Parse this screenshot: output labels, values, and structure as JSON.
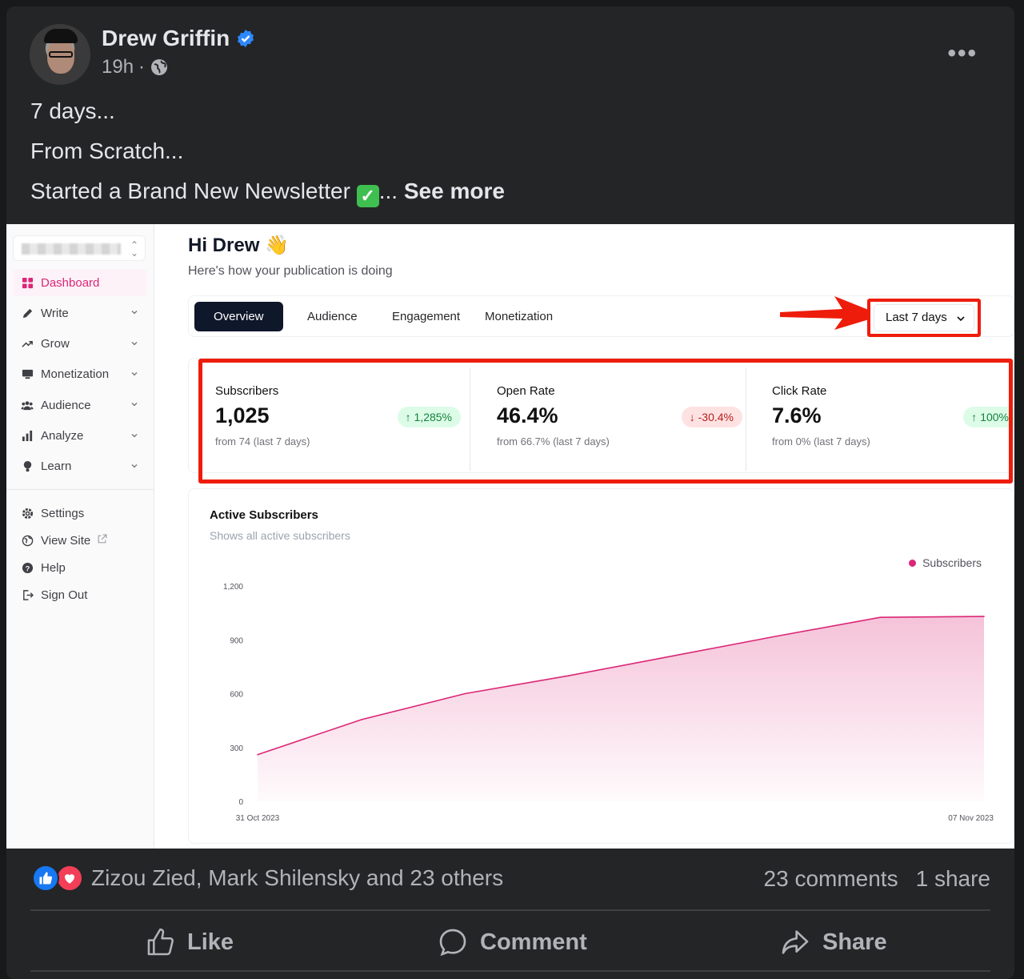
{
  "post": {
    "author": "Drew Griffin",
    "time": "19h",
    "separator": "·",
    "more_label": "•••",
    "lines": [
      "7 days...",
      "From Scratch...",
      "Started a Brand New Newsletter"
    ],
    "line3_suffix": "...",
    "see_more": "See more"
  },
  "dashboard": {
    "sidebar": {
      "items": [
        {
          "label": "Dashboard",
          "icon": "grid-icon"
        },
        {
          "label": "Write",
          "icon": "pencil-icon"
        },
        {
          "label": "Grow",
          "icon": "trend-icon"
        },
        {
          "label": "Monetization",
          "icon": "monitor-icon"
        },
        {
          "label": "Audience",
          "icon": "users-icon"
        },
        {
          "label": "Analyze",
          "icon": "bar-chart-icon"
        },
        {
          "label": "Learn",
          "icon": "bulb-icon"
        }
      ],
      "bottom_items": [
        {
          "label": "Settings",
          "icon": "gear-icon"
        },
        {
          "label": "View Site",
          "icon": "globe-icon"
        },
        {
          "label": "Help",
          "icon": "help-icon"
        },
        {
          "label": "Sign Out",
          "icon": "sign-out-icon"
        }
      ]
    },
    "greeting": "Hi Drew 👋",
    "subtitle": "Here's how your publication is doing",
    "tabs": [
      "Overview",
      "Audience",
      "Engagement",
      "Monetization"
    ],
    "range": "Last 7 days",
    "stats": [
      {
        "label": "Subscribers",
        "value": "1,025",
        "change": "1,285%",
        "direction": "up",
        "from": "from 74 (last 7 days)"
      },
      {
        "label": "Open Rate",
        "value": "46.4%",
        "change": "-30.4%",
        "direction": "down",
        "from": "from 66.7% (last 7 days)"
      },
      {
        "label": "Click Rate",
        "value": "7.6%",
        "change": "100%",
        "direction": "up",
        "from": "from 0% (last 7 days)"
      }
    ],
    "chart_title": "Active Subscribers",
    "chart_subtitle": "Shows all active subscribers"
  },
  "chart_data": {
    "type": "area",
    "title": "Active Subscribers",
    "subtitle": "Shows all active subscribers",
    "xlabel": "",
    "ylabel": "",
    "x_tick_labels": [
      "31 Oct 2023",
      "07 Nov 2023"
    ],
    "y_ticks": [
      0,
      300,
      600,
      900,
      1200
    ],
    "y_tick_labels": [
      "0",
      "300",
      "600",
      "900",
      "1,200"
    ],
    "ylim": [
      0,
      1200
    ],
    "x": [
      0,
      1,
      2,
      3,
      4,
      5,
      6,
      7
    ],
    "series": [
      {
        "name": "Subscribers",
        "color": "#db2777",
        "values": [
          260,
          455,
          600,
          700,
          810,
          920,
          1025,
          1030
        ]
      }
    ],
    "grid": false,
    "legend": "top-right"
  },
  "footer": {
    "reaction_names": "Zizou Zied, Mark Shilensky and 23 others",
    "comments": "23 comments",
    "shares": "1 share",
    "actions": [
      "Like",
      "Comment",
      "Share"
    ]
  },
  "colors": {
    "accent": "#db2777",
    "highlight_red": "#ee1c0b",
    "facebook_blue": "#1877f2"
  }
}
